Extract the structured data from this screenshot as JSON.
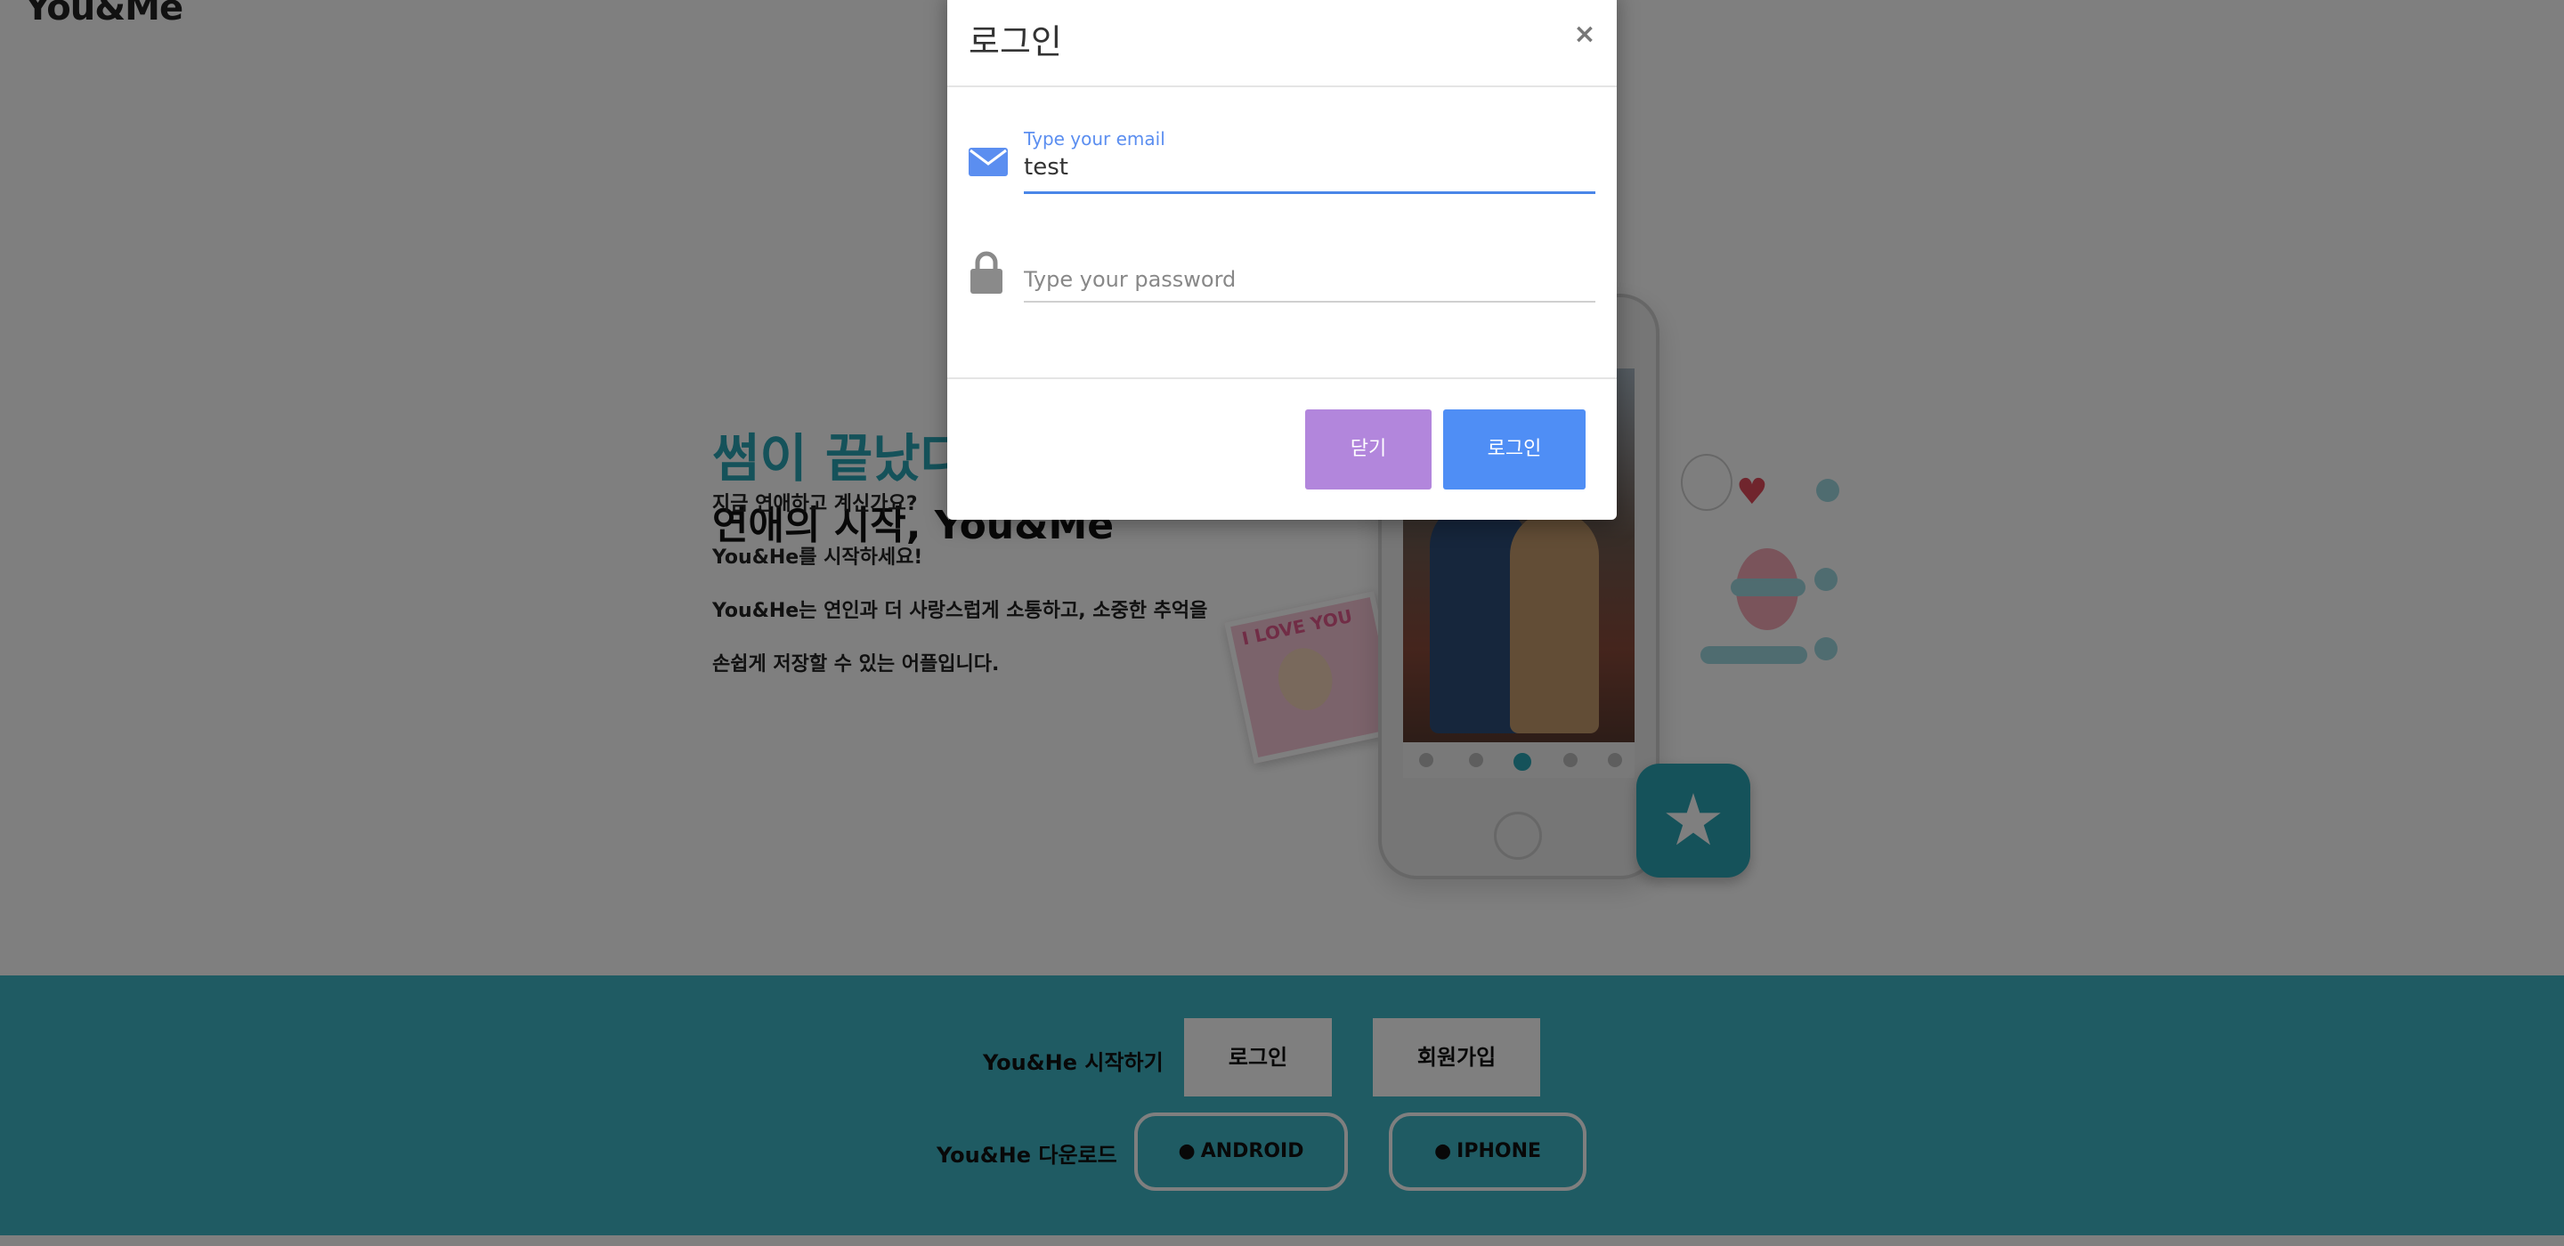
{
  "navbar": {
    "brand": "You&Me"
  },
  "hero": {
    "title": "썸이 끝났다면,",
    "subtitle": "연애의 시작, You&Me",
    "lines": [
      "지금 연애하고 계신가요?",
      "You&He를 시작하세요!",
      "You&He는 연인과 더 사랑스럽게 소통하고, 소중한 추억을",
      "손쉽게 저장할 수 있는 어플입니다."
    ],
    "polaroid_text": "I LOVE YOU"
  },
  "footer": {
    "start_label": "You&He 시작하기",
    "login_button": "로그인",
    "signup_button": "회원가입",
    "download_label": "You&He 다운로드",
    "android_button": "ANDROID",
    "iphone_button": "IPHONE",
    "android_icon": "android-icon",
    "iphone_icon": "apple-icon"
  },
  "modal": {
    "title": "로그인",
    "close_symbol": "×",
    "email": {
      "label": "Type your email",
      "value": "test",
      "icon": "envelope-icon"
    },
    "password": {
      "placeholder": "Type your password",
      "icon": "lock-icon"
    },
    "close_button": "닫기",
    "login_button": "로그인"
  },
  "colors": {
    "accent_teal": "#2aa5b4",
    "footer_bg": "#3fb6c6",
    "primary_blue": "#4f8ef5",
    "secondary_purple": "#b286dc"
  }
}
